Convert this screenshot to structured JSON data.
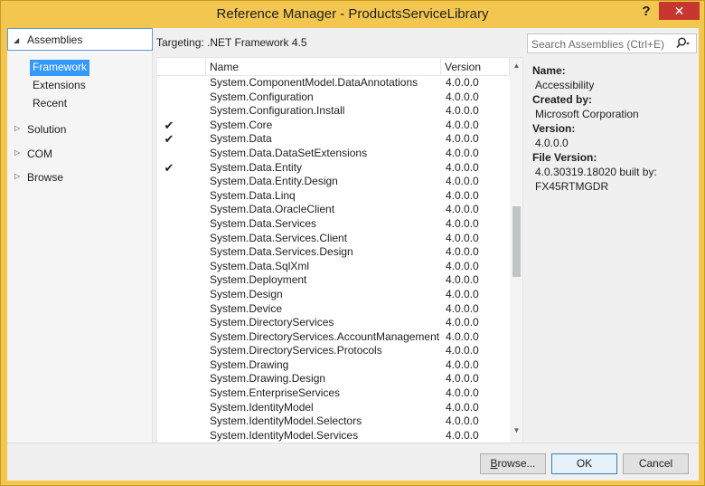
{
  "window": {
    "title": "Reference Manager - ProductsServiceLibrary",
    "help_glyph": "?",
    "close_glyph": "✕"
  },
  "nav": {
    "assemblies": "Assemblies",
    "sub_items": [
      {
        "label": "Framework",
        "selected": true
      },
      {
        "label": "Extensions",
        "selected": false
      },
      {
        "label": "Recent",
        "selected": false
      }
    ],
    "groups": [
      "Solution",
      "COM",
      "Browse"
    ]
  },
  "targeting": "Targeting: .NET Framework 4.5",
  "search": {
    "placeholder": "Search Assemblies (Ctrl+E)"
  },
  "table": {
    "headers": {
      "name": "Name",
      "version": "Version"
    },
    "rows": [
      {
        "name": "System.ComponentModel.DataAnnotations",
        "version": "4.0.0.0",
        "checked": false
      },
      {
        "name": "System.Configuration",
        "version": "4.0.0.0",
        "checked": false
      },
      {
        "name": "System.Configuration.Install",
        "version": "4.0.0.0",
        "checked": false
      },
      {
        "name": "System.Core",
        "version": "4.0.0.0",
        "checked": true
      },
      {
        "name": "System.Data",
        "version": "4.0.0.0",
        "checked": true
      },
      {
        "name": "System.Data.DataSetExtensions",
        "version": "4.0.0.0",
        "checked": false
      },
      {
        "name": "System.Data.Entity",
        "version": "4.0.0.0",
        "checked": true
      },
      {
        "name": "System.Data.Entity.Design",
        "version": "4.0.0.0",
        "checked": false
      },
      {
        "name": "System.Data.Linq",
        "version": "4.0.0.0",
        "checked": false
      },
      {
        "name": "System.Data.OracleClient",
        "version": "4.0.0.0",
        "checked": false
      },
      {
        "name": "System.Data.Services",
        "version": "4.0.0.0",
        "checked": false
      },
      {
        "name": "System.Data.Services.Client",
        "version": "4.0.0.0",
        "checked": false
      },
      {
        "name": "System.Data.Services.Design",
        "version": "4.0.0.0",
        "checked": false
      },
      {
        "name": "System.Data.SqlXml",
        "version": "4.0.0.0",
        "checked": false
      },
      {
        "name": "System.Deployment",
        "version": "4.0.0.0",
        "checked": false
      },
      {
        "name": "System.Design",
        "version": "4.0.0.0",
        "checked": false
      },
      {
        "name": "System.Device",
        "version": "4.0.0.0",
        "checked": false
      },
      {
        "name": "System.DirectoryServices",
        "version": "4.0.0.0",
        "checked": false
      },
      {
        "name": "System.DirectoryServices.AccountManagement",
        "version": "4.0.0.0",
        "checked": false
      },
      {
        "name": "System.DirectoryServices.Protocols",
        "version": "4.0.0.0",
        "checked": false
      },
      {
        "name": "System.Drawing",
        "version": "4.0.0.0",
        "checked": false
      },
      {
        "name": "System.Drawing.Design",
        "version": "4.0.0.0",
        "checked": false
      },
      {
        "name": "System.EnterpriseServices",
        "version": "4.0.0.0",
        "checked": false
      },
      {
        "name": "System.IdentityModel",
        "version": "4.0.0.0",
        "checked": false
      },
      {
        "name": "System.IdentityModel.Selectors",
        "version": "4.0.0.0",
        "checked": false
      },
      {
        "name": "System.IdentityModel.Services",
        "version": "4.0.0.0",
        "checked": false
      }
    ]
  },
  "details": {
    "name_label": "Name:",
    "name_value": "Accessibility",
    "created_label": "Created by:",
    "created_value": "Microsoft Corporation",
    "version_label": "Version:",
    "version_value": "4.0.0.0",
    "file_version_label": "File Version:",
    "file_version_line1": "4.0.30319.18020 built by:",
    "file_version_line2": "FX45RTMGDR"
  },
  "buttons": {
    "browse_prefix": "B",
    "browse_rest": "rowse...",
    "ok": "OK",
    "cancel": "Cancel"
  },
  "colors": {
    "titlebar": "#f3c64f",
    "close": "#c7372f",
    "selected": "#3399ff"
  }
}
